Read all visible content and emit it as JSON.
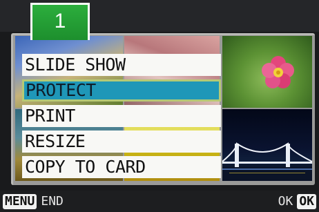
{
  "tab": {
    "number": "1",
    "color": "#22a336"
  },
  "menu": {
    "items": [
      {
        "label": "SLIDE SHOW",
        "selected": false
      },
      {
        "label": "PROTECT",
        "selected": true
      },
      {
        "label": "PRINT",
        "selected": false
      },
      {
        "label": "RESIZE",
        "selected": false
      },
      {
        "label": "COPY TO CARD",
        "selected": false
      }
    ],
    "selected_color": "#1f97b8"
  },
  "footer": {
    "left_key": "MENU",
    "left_label": "END",
    "right_label": "OK",
    "right_key": "OK"
  }
}
